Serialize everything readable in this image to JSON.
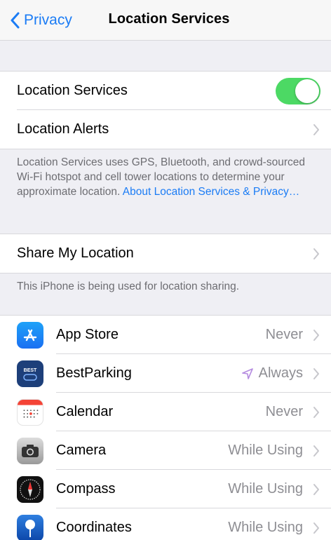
{
  "nav": {
    "back_label": "Privacy",
    "title": "Location Services"
  },
  "main_group": {
    "location_services_label": "Location Services",
    "location_services_on": true,
    "location_alerts_label": "Location Alerts"
  },
  "description": {
    "text": "Location Services uses GPS, Bluetooth, and crowd-sourced Wi-Fi hotspot and cell tower locations to determine your approximate location. ",
    "link": "About Location Services & Privacy…"
  },
  "share": {
    "label": "Share My Location",
    "footnote": "This iPhone is being used for location sharing."
  },
  "apps": [
    {
      "name": "App Store",
      "value": "Never",
      "icon": "app-store-icon"
    },
    {
      "name": "BestParking",
      "value": "Always",
      "icon": "bestparking-icon",
      "icon_text": "BEST",
      "location_arrow": true
    },
    {
      "name": "Calendar",
      "value": "Never",
      "icon": "calendar-icon"
    },
    {
      "name": "Camera",
      "value": "While Using",
      "icon": "camera-icon"
    },
    {
      "name": "Compass",
      "value": "While Using",
      "icon": "compass-icon"
    },
    {
      "name": "Coordinates",
      "value": "While Using",
      "icon": "coordinates-icon"
    }
  ],
  "colors": {
    "accent": "#1b7cf5",
    "toggle_on": "#4cd964",
    "location_arrow": "#b58ce0"
  }
}
